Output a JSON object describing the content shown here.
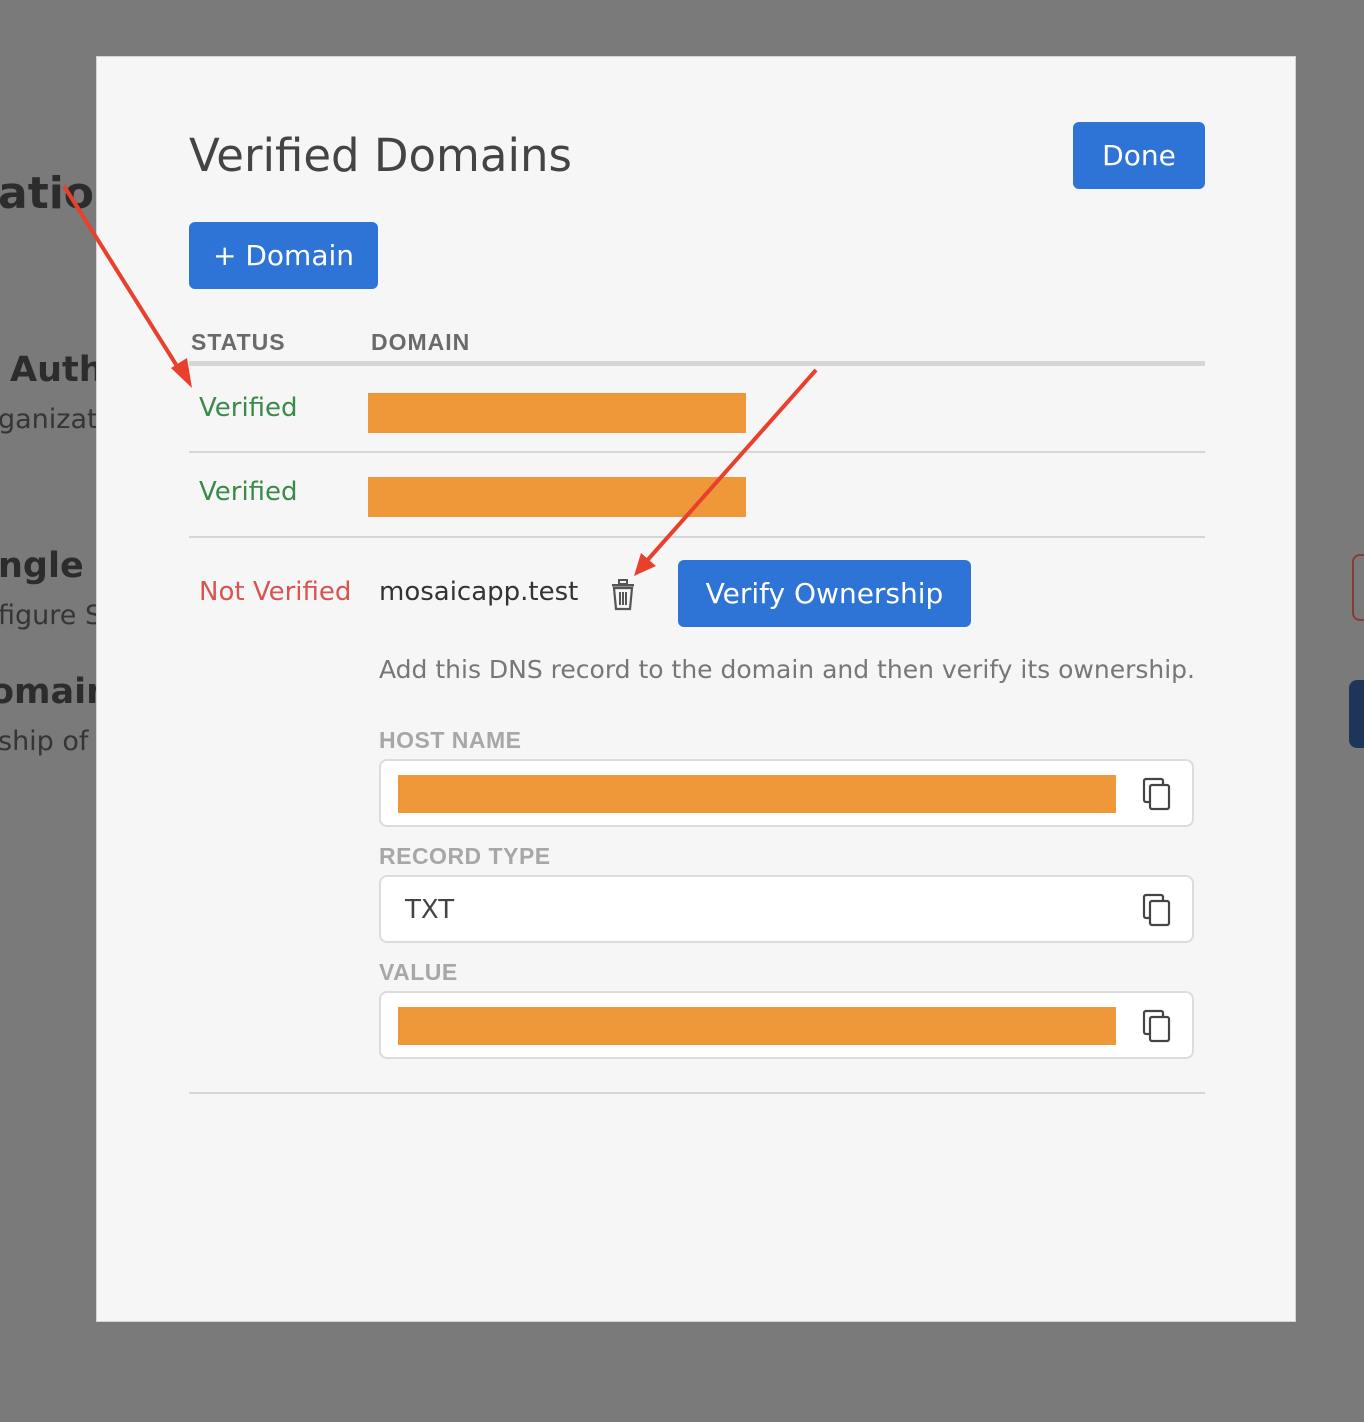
{
  "background": {
    "fragments": [
      "ation",
      "Authe",
      "ganizatio",
      "ngle Si",
      "figure SA",
      "omain",
      "ship of y"
    ]
  },
  "modal": {
    "title": "Verified Domains",
    "done_label": "Done",
    "add_domain_label": "+ Domain",
    "table": {
      "columns": [
        "STATUS",
        "DOMAIN"
      ],
      "rows": [
        {
          "status": "Verified",
          "domain": ""
        },
        {
          "status": "Verified",
          "domain": ""
        },
        {
          "status": "Not Verified",
          "domain": "mosaicapp.test"
        }
      ]
    },
    "verify_label": "Verify Ownership",
    "help_text": "Add this DNS record to the domain and then verify its ownership.",
    "fields": {
      "host_name_label": "HOST NAME",
      "host_name_value": "",
      "record_type_label": "RECORD TYPE",
      "record_type_value": "TXT",
      "value_label": "VALUE",
      "value_value": ""
    }
  },
  "colors": {
    "primary_button": "#2e73d6",
    "verified": "#3a8a4a",
    "not_verified": "#d95450",
    "redaction": "#ef9839",
    "annotation_arrow": "#e8402c"
  },
  "icons": [
    "trash-icon",
    "copy-icon"
  ]
}
